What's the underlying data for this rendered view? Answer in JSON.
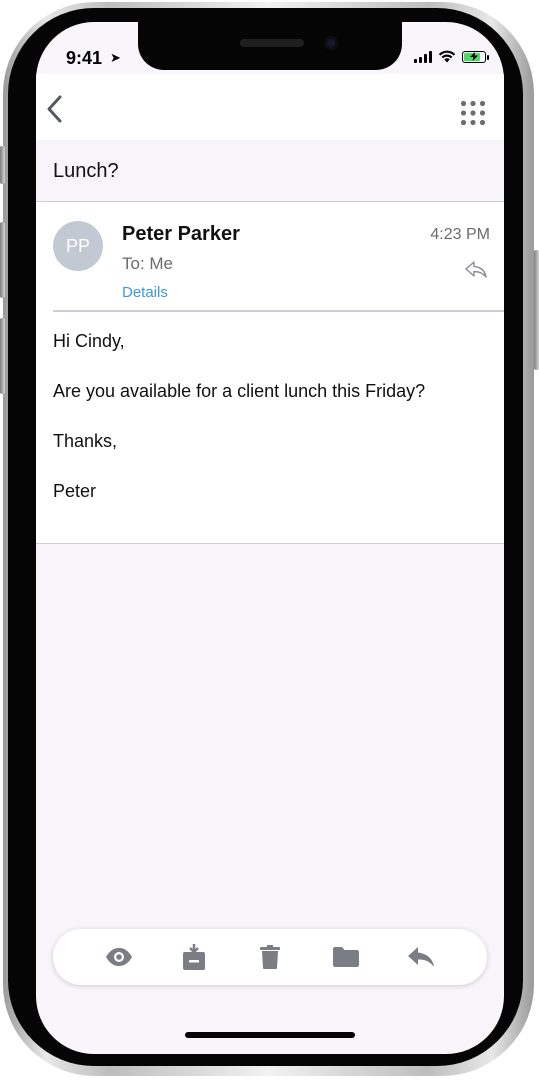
{
  "status_bar": {
    "time": "9:41",
    "location_glyph": "➤",
    "battery_percent": 80,
    "battery_color": "#4cd964"
  },
  "nav": {
    "back_icon": "chevron-left-icon",
    "apps_icon": "grid-dots-icon"
  },
  "email": {
    "subject": "Lunch?",
    "avatar_initials": "PP",
    "sender": "Peter Parker",
    "to": "To: Me",
    "details_link": "Details",
    "time": "4:23 PM",
    "body": [
      "Hi Cindy,",
      "Are you available for a client lunch this Friday?",
      "Thanks,",
      "Peter"
    ]
  },
  "toolbar": {
    "items": [
      "eye-icon",
      "archive-icon",
      "trash-icon",
      "folder-icon",
      "reply-icon"
    ],
    "icon_color": "#7a7d84"
  },
  "colors": {
    "link": "#3a9bd8",
    "screen_background": "#f9f6fb"
  }
}
